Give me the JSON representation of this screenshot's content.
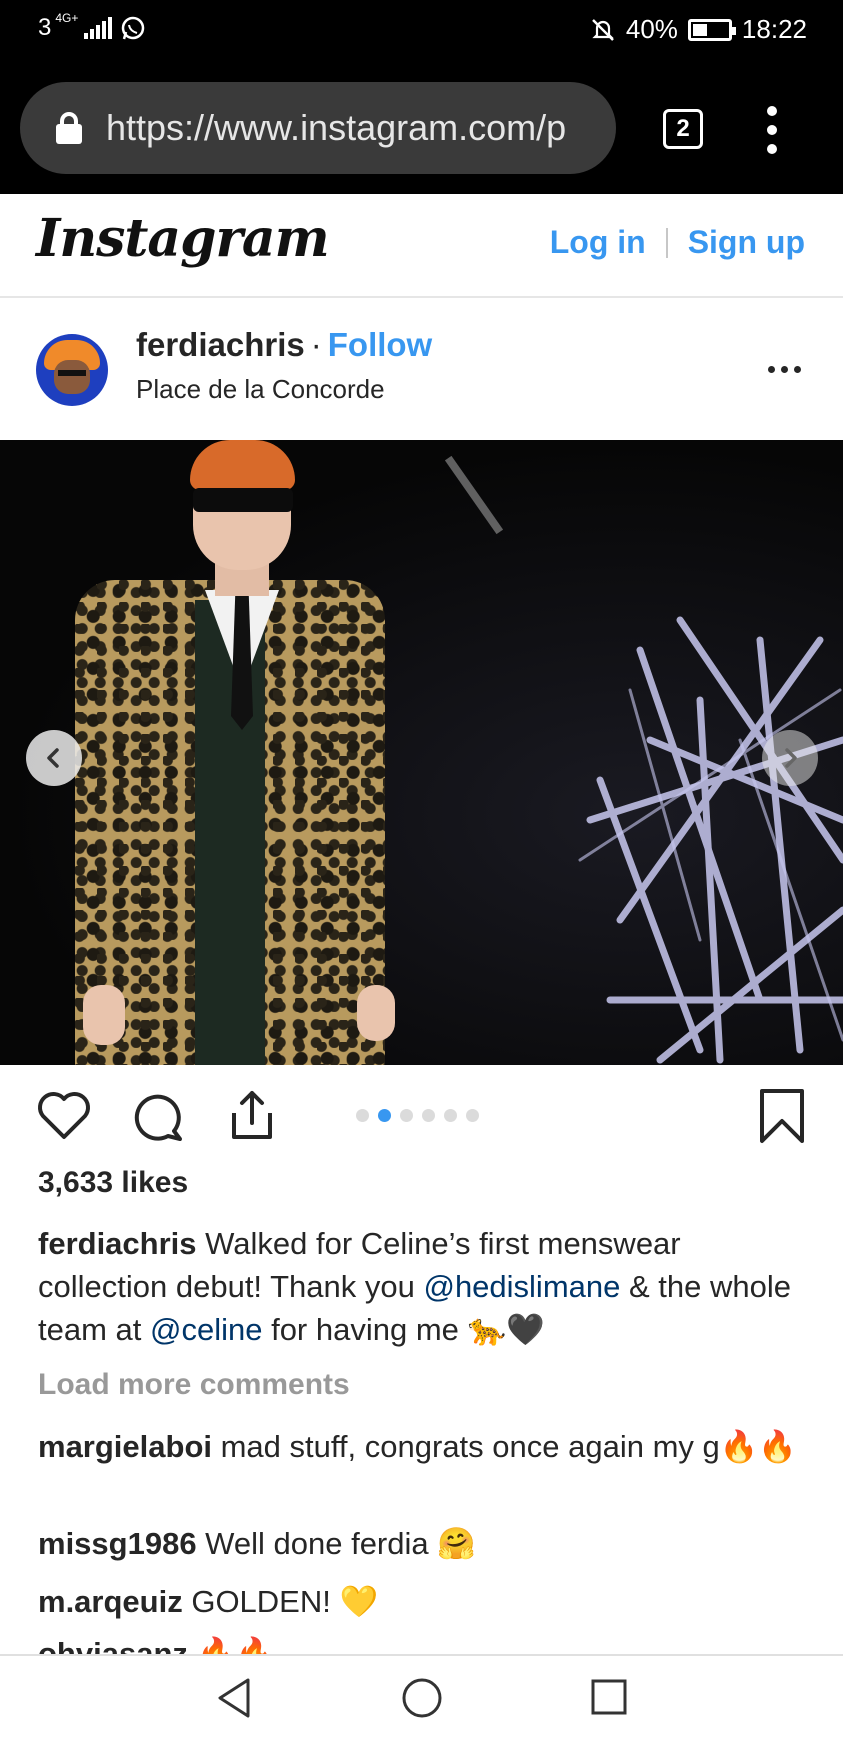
{
  "status_bar": {
    "network": "3",
    "network_tag": "4G+",
    "battery": "40%",
    "time": "18:22",
    "mute_icon": "mute-icon",
    "whatsapp_icon": "whatsapp-icon"
  },
  "browser": {
    "url": "https://www.instagram.com/p",
    "tab_count": "2"
  },
  "header": {
    "logo": "Instagram",
    "login": "Log in",
    "signup": "Sign up"
  },
  "post": {
    "username": "ferdiachris",
    "follow": "Follow",
    "separator": "·",
    "location": "Place de la Concorde",
    "carousel": {
      "total": 6,
      "active_index": 1
    },
    "likes": "3,633 likes",
    "caption": {
      "username": "ferdiachris",
      "text_1": " Walked for Celine’s first menswear collection debut! Thank you ",
      "mention_1": "@hedislimane",
      "text_2": " & the whole team at ",
      "mention_2": "@celine",
      "text_3": " for having me 🐆🖤"
    },
    "load_more": "Load more comments",
    "comments": [
      {
        "user": "margielaboi",
        "text": " mad stuff, congrats once again my g🔥🔥"
      },
      {
        "user": "missg1986",
        "text": " Well done ferdia 🤗"
      },
      {
        "user": "m.arqeuiz",
        "text": " GOLDEN! 💛"
      },
      {
        "user": "ohviasanz",
        "text": " 🔥🔥"
      }
    ]
  },
  "colors": {
    "link_blue": "#3897f0",
    "mention_blue": "#003569",
    "text": "#262626",
    "muted": "#999999"
  }
}
